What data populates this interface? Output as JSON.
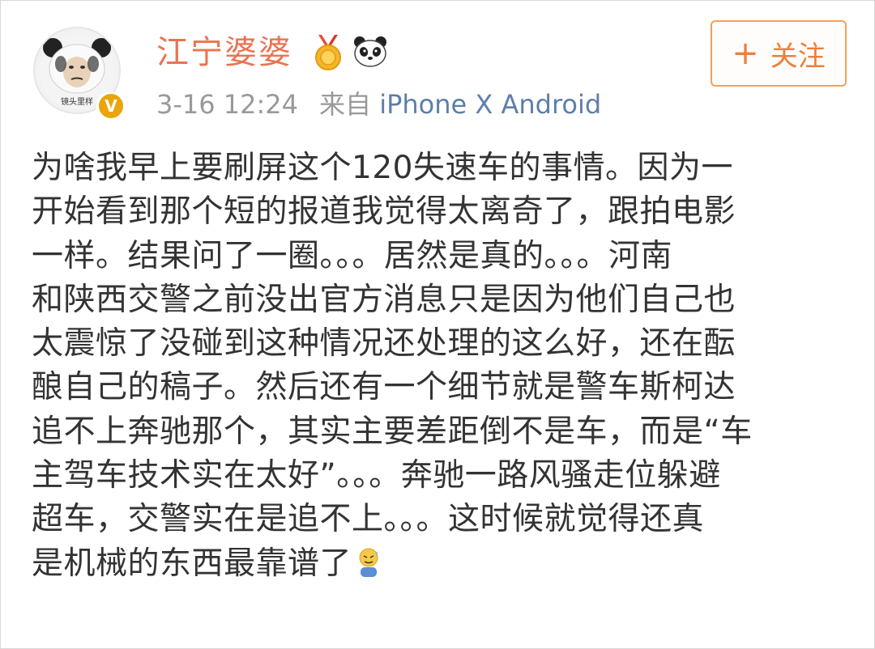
{
  "user": {
    "name": "江宁婆婆",
    "avatar_caption": "镜头里样",
    "verified_badge": "V",
    "medal_icon": "gold-medal-icon",
    "panda_icon": "panda-icon"
  },
  "post": {
    "time": "3-16 12:24",
    "source_prefix": "来自",
    "source_device": "iPhone X Android",
    "lines": [
      "为啥我早上要刷屏这个120失速车的事情。因为一",
      "开始看到那个短的报道我觉得太离奇了，跟拍电影",
      "一样。结果问了一圈。。。居然是真的。。。河南",
      "和陕西交警之前没出官方消息只是因为他们自己也",
      "太震惊了没碰到这种情况还处理的这么好，还在酝",
      "酿自己的稿子。然后还有一个细节就是警车斯柯达",
      "追不上奔驰那个，其实主要差距倒不是车，而是“车",
      "主驾车技术实在太好”。。。奔驰一路风骚走位躲避",
      "超车，交警实在是追不上。。。这时候就觉得还真",
      "是机械的东西最靠谱了"
    ],
    "trailing_emoji": "sweat-smile-emoji-icon"
  },
  "actions": {
    "follow_plus": "+",
    "follow_label": "关注"
  },
  "colors": {
    "username": "#eb7350",
    "follow_border": "#f6a05a",
    "follow_text": "#f07e38",
    "meta_gray": "#999999",
    "source_link": "#5d7fa8",
    "verified": "#e9a50b",
    "body_text": "#333333"
  }
}
